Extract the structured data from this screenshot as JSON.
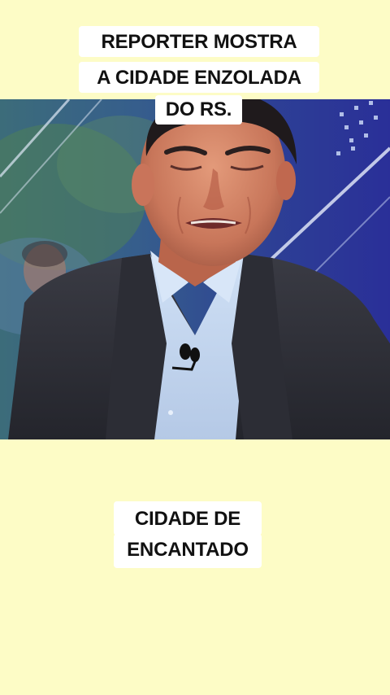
{
  "top_caption": {
    "line1": "REPORTER MOSTRA",
    "line2": "A CIDADE ENZOLADA",
    "line3": "DO RS."
  },
  "bottom_caption": {
    "line1": "CIDADE DE",
    "line2": "ENCANTADO"
  },
  "colors": {
    "page_background": "#fdfcc6",
    "caption_background": "#ffffff",
    "caption_text": "#111111"
  }
}
